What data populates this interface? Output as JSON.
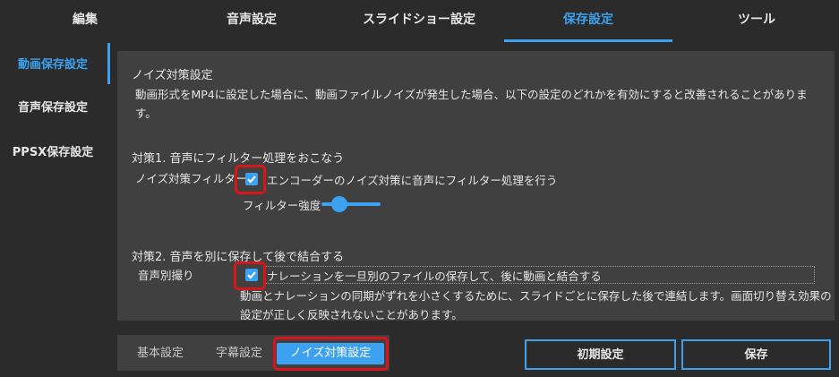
{
  "colors": {
    "accent": "#3ba1f0",
    "highlight": "#d9151b",
    "panel": "#404040",
    "background": "#2b2b2b"
  },
  "tabs": [
    {
      "label": "編集",
      "active": false
    },
    {
      "label": "音声設定",
      "active": false
    },
    {
      "label": "スライドショー設定",
      "active": false
    },
    {
      "label": "保存設定",
      "active": true
    },
    {
      "label": "ツール",
      "active": false
    }
  ],
  "sidebar": {
    "items": [
      {
        "label": "動画保存設定",
        "active": true
      },
      {
        "label": "音声保存設定",
        "active": false
      },
      {
        "label": "PPSX保存設定",
        "active": false
      }
    ]
  },
  "noise": {
    "title": "ノイズ対策設定",
    "desc_line1": "動画形式をMP4に設定した場合に、動画ファイルノイズが発生した場合、以下の設定のどれかを有効にすると改善されることがありま",
    "desc_line2": "す。"
  },
  "measure1": {
    "heading": "対策1. 音声にフィルター処理をおこなう",
    "label": "ノイズ対策フィルター",
    "checkbox_label": "エンコーダーのノイズ対策に音声にフィルター処理を行う",
    "checked": true,
    "slider_label": "フィルター強度",
    "slider_icon": "slider-thumb"
  },
  "measure2": {
    "heading": "対策2. 音声を別に保存して後で結合する",
    "label": "音声別撮り",
    "checkbox_label": "ナレーションを一旦別のファイルの保存して、後に動画と結合する",
    "checked": true,
    "note_line1": "動画とナレーションの同期がずれを小さくするために、スライドごとに保存した後で連結します。画面切り替え効果の",
    "note_line2": "設定が正しく反映されないことがあります。"
  },
  "bottom_tabs": [
    {
      "label": "基本設定",
      "active": false
    },
    {
      "label": "字幕設定",
      "active": false
    },
    {
      "label": "ノイズ対策設定",
      "active": true
    }
  ],
  "buttons": {
    "reset": "初期設定",
    "save": "保存"
  }
}
